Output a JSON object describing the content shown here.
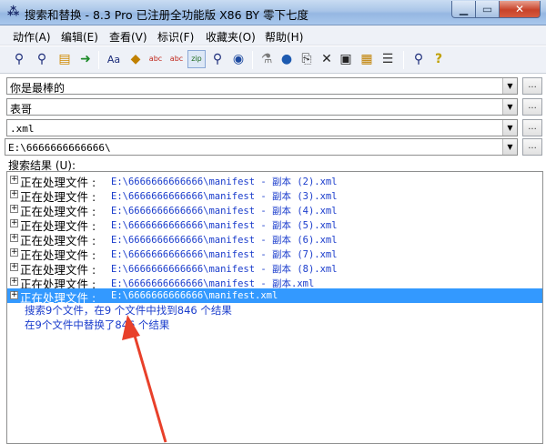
{
  "window": {
    "title": "搜索和替换 - 8.3 Pro 已注册全功能版 X86 BY 零下七度",
    "app_icon": "binoculars-icon",
    "controls": {
      "minimize": "▁",
      "maximize": "▭",
      "close": "✕"
    }
  },
  "menu": {
    "items": [
      {
        "label": "动作(A)"
      },
      {
        "label": "编辑(E)"
      },
      {
        "label": "查看(V)"
      },
      {
        "label": "标识(F)"
      },
      {
        "label": "收藏夹(O)"
      },
      {
        "label": "帮助(H)"
      }
    ]
  },
  "toolbar": {
    "buttons": [
      {
        "icon": "search-icon",
        "glyph": "👓"
      },
      {
        "icon": "search-replace-icon",
        "glyph": "👓"
      },
      {
        "icon": "search-files-icon",
        "glyph": "📂"
      },
      {
        "icon": "replace-files-icon",
        "glyph": "➡"
      },
      {
        "icon": "case-sensitive-icon",
        "glyph": "Aa"
      },
      {
        "icon": "whole-word-icon",
        "glyph": "🏷"
      },
      {
        "icon": "abc-search-icon",
        "glyph": "abc"
      },
      {
        "icon": "abc-replace-icon",
        "glyph": "abc"
      },
      {
        "icon": "zip-search-icon",
        "glyph": "zip"
      },
      {
        "icon": "binary-search-icon",
        "glyph": "🔍"
      },
      {
        "icon": "web-search-icon",
        "glyph": "🌐"
      },
      {
        "icon": "filter-icon",
        "glyph": "⚗"
      },
      {
        "icon": "globe-icon",
        "glyph": "🌍"
      },
      {
        "icon": "copy-icon",
        "glyph": "⎘"
      },
      {
        "icon": "delete-icon",
        "glyph": "✕"
      },
      {
        "icon": "print-icon",
        "glyph": "🖶"
      },
      {
        "icon": "favorites-icon",
        "glyph": "▦"
      },
      {
        "icon": "list-icon",
        "glyph": "☰"
      },
      {
        "icon": "binoculars-icon",
        "glyph": "🔭"
      },
      {
        "icon": "help-icon",
        "glyph": "?"
      }
    ]
  },
  "fields": {
    "search_text": "你是最棒的",
    "replace_text": "表哥",
    "file_mask": ".xml",
    "folder": "E:\\6666666666666\\",
    "browse_label": "..."
  },
  "results": {
    "label": "搜索结果 (U):",
    "rows": [
      {
        "label": "正在处理文件 :",
        "path": "E:\\6666666666666\\manifest - 副本 (2).xml"
      },
      {
        "label": "正在处理文件 :",
        "path": "E:\\6666666666666\\manifest - 副本 (3).xml"
      },
      {
        "label": "正在处理文件 :",
        "path": "E:\\6666666666666\\manifest - 副本 (4).xml"
      },
      {
        "label": "正在处理文件 :",
        "path": "E:\\6666666666666\\manifest - 副本 (5).xml"
      },
      {
        "label": "正在处理文件 :",
        "path": "E:\\6666666666666\\manifest - 副本 (6).xml"
      },
      {
        "label": "正在处理文件 :",
        "path": "E:\\6666666666666\\manifest - 副本 (7).xml"
      },
      {
        "label": "正在处理文件 :",
        "path": "E:\\6666666666666\\manifest - 副本 (8).xml"
      },
      {
        "label": "正在处理文件 :",
        "path": "E:\\6666666666666\\manifest - 副本.xml"
      },
      {
        "label": "正在处理文件 :",
        "path": "E:\\6666666666666\\manifest.xml"
      }
    ],
    "selected_index": 8,
    "summary_1": "搜索9个文件，在9 个文件中找到846 个结果",
    "summary_2": "在9个文件中替换了846 个结果"
  },
  "colors": {
    "title_bar": "#a9c5e8",
    "selection": "#3399ff",
    "result_text": "#1a3ccc",
    "annotation_arrow": "#e8402a"
  }
}
